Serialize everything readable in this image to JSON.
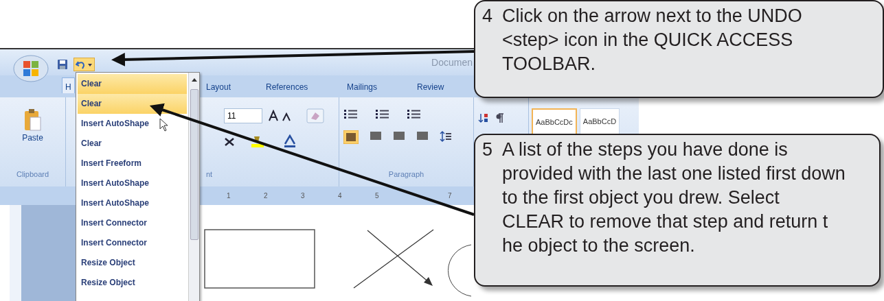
{
  "window": {
    "title": "Documen"
  },
  "quick_access": {
    "undo_menu_open": true
  },
  "ribbon_tabs": [
    {
      "label": "H",
      "selected": true
    },
    {
      "label": "Layout",
      "selected": false
    },
    {
      "label": "References",
      "selected": false
    },
    {
      "label": "Mailings",
      "selected": false
    },
    {
      "label": "Review",
      "selected": false
    }
  ],
  "clipboard": {
    "paste_label": "Paste",
    "group_label": "Clipboard"
  },
  "font": {
    "size": "11",
    "group_label": "nt"
  },
  "paragraph": {
    "group_label": "Paragraph"
  },
  "styles": [
    "AaBbCcDc",
    "AaBbCcD"
  ],
  "ruler_numbers": [
    "1",
    "2",
    "3",
    "4",
    "5",
    "7"
  ],
  "undo_list": [
    {
      "label": "Clear",
      "selected": true
    },
    {
      "label": "Clear",
      "selected": true
    },
    {
      "label": "Insert AutoShape",
      "selected": false
    },
    {
      "label": "Clear",
      "selected": false
    },
    {
      "label": "Insert Freeform",
      "selected": false
    },
    {
      "label": "Insert AutoShape",
      "selected": false
    },
    {
      "label": "Insert AutoShape",
      "selected": false
    },
    {
      "label": "Insert Connector",
      "selected": false
    },
    {
      "label": "Insert Connector",
      "selected": false
    },
    {
      "label": "Resize Object",
      "selected": false
    },
    {
      "label": "Resize Object",
      "selected": false
    }
  ],
  "callouts": [
    {
      "number": "4",
      "text": "Click on the arrow next to the UNDO <step> icon in the QUICK ACCESS TOOLBAR."
    },
    {
      "number": "5",
      "text": "A list of the steps you have done is provided with the last one listed first down to the first object you drew. Select CLEAR to remove that step and return t he object to the screen."
    }
  ]
}
